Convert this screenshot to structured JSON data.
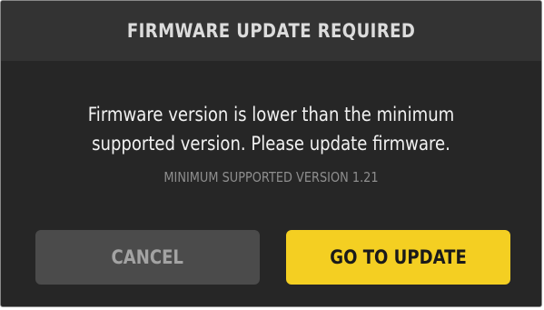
{
  "dialog": {
    "title": "FIRMWARE UPDATE REQUIRED",
    "message_line1": "Firmware version is lower than the minimum",
    "message_line2": "supported version. Please update firmware.",
    "minimum_version_text": "MINIMUM SUPPORTED VERSION 1.21",
    "buttons": {
      "cancel_label": "CANCEL",
      "update_label": "GO TO UPDATE"
    }
  },
  "colors": {
    "dialog_background": "#262626",
    "header_background": "#333333",
    "primary_accent": "#f4cf22",
    "secondary_button": "#4b4b4b"
  }
}
